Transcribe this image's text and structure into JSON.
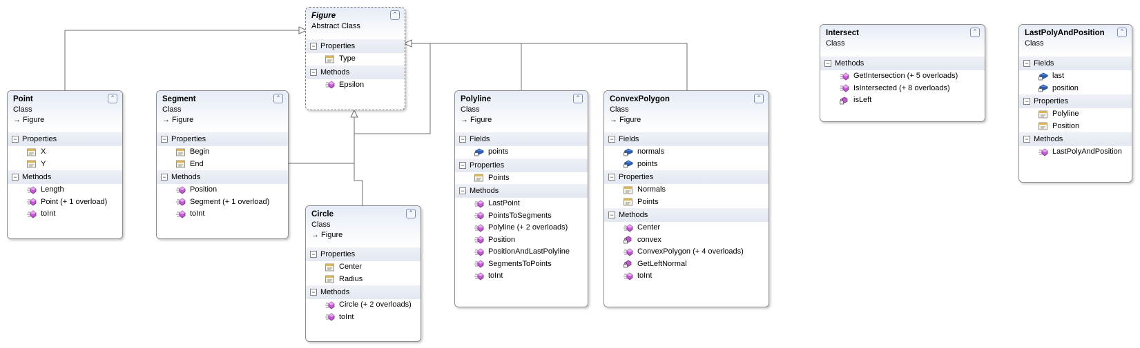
{
  "classes": {
    "figure": {
      "name": "Figure",
      "kind": "Abstract Class",
      "sections": [
        {
          "title": "Properties",
          "members": [
            {
              "label": "Type",
              "icon": "property-icon"
            }
          ]
        },
        {
          "title": "Methods",
          "members": [
            {
              "label": "Epsilon",
              "icon": "method-icon"
            }
          ]
        }
      ]
    },
    "point": {
      "name": "Point",
      "kind": "Class",
      "base": "→ Figure",
      "sections": [
        {
          "title": "Properties",
          "members": [
            {
              "label": "X",
              "icon": "property-icon"
            },
            {
              "label": "Y",
              "icon": "property-icon"
            }
          ]
        },
        {
          "title": "Methods",
          "members": [
            {
              "label": "Length",
              "icon": "method-icon"
            },
            {
              "label": "Point (+ 1 overload)",
              "icon": "method-icon"
            },
            {
              "label": "toInt",
              "icon": "method-icon"
            }
          ]
        }
      ]
    },
    "segment": {
      "name": "Segment",
      "kind": "Class",
      "base": "→ Figure",
      "sections": [
        {
          "title": "Properties",
          "members": [
            {
              "label": "Begin",
              "icon": "property-icon"
            },
            {
              "label": "End",
              "icon": "property-icon"
            }
          ]
        },
        {
          "title": "Methods",
          "members": [
            {
              "label": "Position",
              "icon": "method-icon"
            },
            {
              "label": "Segment (+ 1 overload)",
              "icon": "method-icon"
            },
            {
              "label": "toInt",
              "icon": "method-icon"
            }
          ]
        }
      ]
    },
    "circle": {
      "name": "Circle",
      "kind": "Class",
      "base": "→ Figure",
      "sections": [
        {
          "title": "Properties",
          "members": [
            {
              "label": "Center",
              "icon": "property-icon"
            },
            {
              "label": "Radius",
              "icon": "property-icon"
            }
          ]
        },
        {
          "title": "Methods",
          "members": [
            {
              "label": "Circle (+ 2 overloads)",
              "icon": "method-icon"
            },
            {
              "label": "toInt",
              "icon": "method-icon"
            }
          ]
        }
      ]
    },
    "polyline": {
      "name": "Polyline",
      "kind": "Class",
      "base": "→ Figure",
      "sections": [
        {
          "title": "Fields",
          "members": [
            {
              "label": "points",
              "icon": "private-field-icon"
            }
          ]
        },
        {
          "title": "Properties",
          "members": [
            {
              "label": "Points",
              "icon": "property-icon"
            }
          ]
        },
        {
          "title": "Methods",
          "members": [
            {
              "label": "LastPoint",
              "icon": "method-icon"
            },
            {
              "label": "PointsToSegments",
              "icon": "method-icon"
            },
            {
              "label": "Polyline (+ 2 overloads)",
              "icon": "method-icon"
            },
            {
              "label": "Position",
              "icon": "method-icon"
            },
            {
              "label": "PositionAndLastPolyline",
              "icon": "method-icon"
            },
            {
              "label": "SegmentsToPoints",
              "icon": "method-icon"
            },
            {
              "label": "toInt",
              "icon": "method-icon"
            }
          ]
        }
      ]
    },
    "convexpolygon": {
      "name": "ConvexPolygon",
      "kind": "Class",
      "base": "→ Figure",
      "sections": [
        {
          "title": "Fields",
          "members": [
            {
              "label": "normals",
              "icon": "private-field-icon"
            },
            {
              "label": "points",
              "icon": "private-field-icon"
            }
          ]
        },
        {
          "title": "Properties",
          "members": [
            {
              "label": "Normals",
              "icon": "property-icon"
            },
            {
              "label": "Points",
              "icon": "property-icon"
            }
          ]
        },
        {
          "title": "Methods",
          "members": [
            {
              "label": "Center",
              "icon": "method-icon"
            },
            {
              "label": "convex",
              "icon": "private-method-icon"
            },
            {
              "label": "ConvexPolygon (+ 4 overloads)",
              "icon": "method-icon"
            },
            {
              "label": "GetLeftNormal",
              "icon": "private-method-icon"
            },
            {
              "label": "toInt",
              "icon": "method-icon"
            }
          ]
        }
      ]
    },
    "intersect": {
      "name": "Intersect",
      "kind": "Class",
      "sections": [
        {
          "title": "Methods",
          "members": [
            {
              "label": "GetIntersection (+ 5 overloads)",
              "icon": "method-icon"
            },
            {
              "label": "IsIntersected (+ 8 overloads)",
              "icon": "method-icon"
            },
            {
              "label": "isLeft",
              "icon": "private-method-icon"
            }
          ]
        }
      ]
    },
    "lastpoly": {
      "name": "LastPolyAndPosition",
      "kind": "Class",
      "sections": [
        {
          "title": "Fields",
          "members": [
            {
              "label": "last",
              "icon": "private-field-icon"
            },
            {
              "label": "position",
              "icon": "private-field-icon"
            }
          ]
        },
        {
          "title": "Properties",
          "members": [
            {
              "label": "Polyline",
              "icon": "property-icon"
            },
            {
              "label": "Position",
              "icon": "property-icon"
            }
          ]
        },
        {
          "title": "Methods",
          "members": [
            {
              "label": "LastPolyAndPosition",
              "icon": "method-icon"
            }
          ]
        }
      ]
    }
  },
  "ui": {
    "collapse_glyph": "⌃",
    "section_toggle_glyph": "−"
  },
  "colors": {
    "connector": "#6e6e6e",
    "header_gradient_top": "#e6ecf6",
    "method_purple": "#b04ac0",
    "field_blue": "#2f5fb8",
    "property_tan": "#d0a94e"
  }
}
